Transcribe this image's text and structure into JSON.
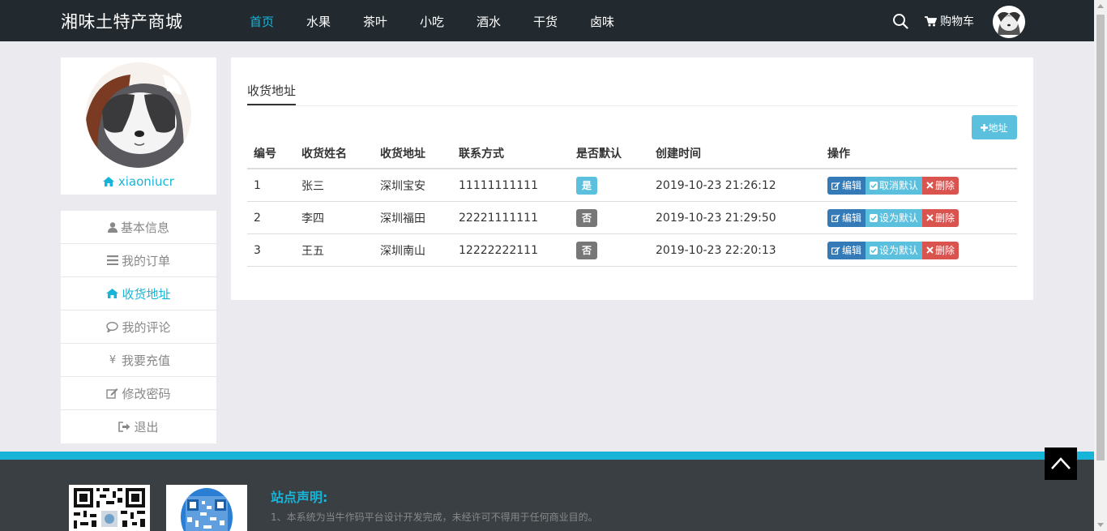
{
  "nav": {
    "brand": "湘味土特产商城",
    "items": [
      {
        "label": "首页",
        "active": true
      },
      {
        "label": "水果"
      },
      {
        "label": "茶叶"
      },
      {
        "label": "小吃"
      },
      {
        "label": "酒水"
      },
      {
        "label": "干货"
      },
      {
        "label": "卤味"
      }
    ],
    "cart_label": "购物车"
  },
  "profile": {
    "username": "xiaoniucr"
  },
  "side_menu": [
    {
      "label": "基本信息",
      "icon": "user-icon"
    },
    {
      "label": "我的订单",
      "icon": "bars-icon"
    },
    {
      "label": "收货地址",
      "icon": "home-icon",
      "active": true
    },
    {
      "label": "我的评论",
      "icon": "comment-icon"
    },
    {
      "label": "我要充值",
      "icon": "yen-icon"
    },
    {
      "label": "修改密码",
      "icon": "edit-icon"
    },
    {
      "label": "退出",
      "icon": "signout-icon"
    }
  ],
  "main": {
    "tab_title": "收货地址",
    "add_button": "地址",
    "headers": [
      "编号",
      "收货姓名",
      "收货地址",
      "联系方式",
      "是否默认",
      "创建时间",
      "操作"
    ],
    "rows": [
      {
        "id": "1",
        "name": "张三",
        "address": "深圳宝安",
        "phone": "11111111111",
        "default": "是",
        "is_default": true,
        "created": "2019-10-23 21:26:12",
        "default_action": "取消默认"
      },
      {
        "id": "2",
        "name": "李四",
        "address": "深圳福田",
        "phone": "22221111111",
        "default": "否",
        "is_default": false,
        "created": "2019-10-23 21:29:50",
        "default_action": "设为默认"
      },
      {
        "id": "3",
        "name": "王五",
        "address": "深圳南山",
        "phone": "12222222111",
        "default": "否",
        "is_default": false,
        "created": "2019-10-23 22:20:13",
        "default_action": "设为默认"
      }
    ],
    "edit_label": "编辑",
    "delete_label": "删除"
  },
  "footer": {
    "notice_title": "站点声明:",
    "notice_text": "1、本系统为当牛作码平台设计开发完成，未经许可不得用于任何商业目的。"
  },
  "colors": {
    "accent": "#18b4d8",
    "navbar": "#222a2f",
    "footer": "#3a3f43"
  }
}
